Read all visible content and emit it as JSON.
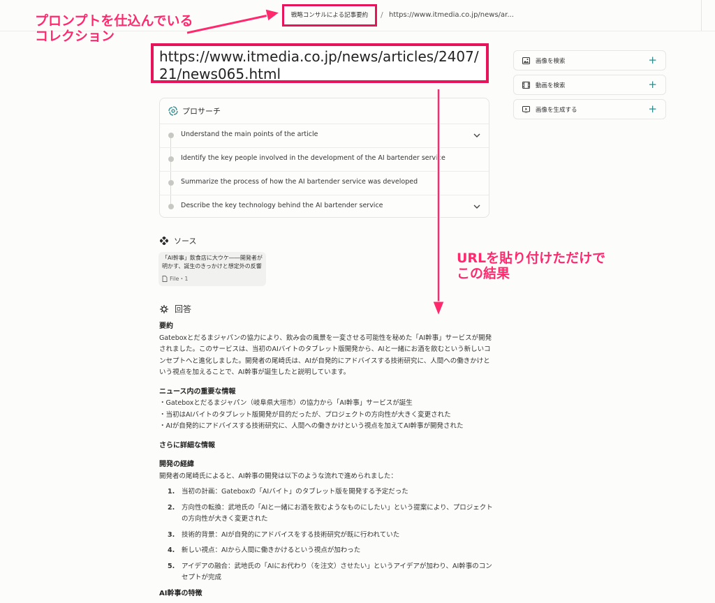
{
  "breadcrumb": {
    "collection": "戦略コンサルによる記事要約",
    "separator": "/",
    "page": "https://www.itmedia.co.jp/news/ar..."
  },
  "annotations": {
    "top_left_line1": "プロンプトを仕込んでいる",
    "top_left_line2": "コレクション",
    "right_line1": "URLを貼り付けただけで",
    "right_line2": "この結果"
  },
  "query": "https://www.itmedia.co.jp/news/articles/2407/21/news065.html",
  "pro_search": {
    "title": "プロサーチ",
    "steps": [
      {
        "text": "Understand the main points of the article"
      },
      {
        "text": "Identify the key people involved in the development of the AI bartender service"
      },
      {
        "text": "Summarize the process of how the AI bartender service was developed"
      },
      {
        "text": "Describe the key technology behind the AI bartender service"
      }
    ]
  },
  "sources": {
    "title": "ソース",
    "cards": [
      {
        "title": "「AI幹事」飲食店に大ウケ――開発者が明かす、誕生のきっかけと想定外の反響 人...",
        "meta": "File・1"
      }
    ]
  },
  "answer": {
    "title": "回答",
    "summary_heading": "要約",
    "summary": "Gateboxとだるまジャパンの協力により、飲み会の風景を一変させる可能性を秘めた「AI幹事」サービスが開発されました。このサービスは、当初のAIバイトのタブレット版開発から、AIと一緒にお酒を飲むという新しいコンセプトへと進化しました。開発者の尾崎氏は、AIが自発的にアドバイスする技術研究に、人間への働きかけという視点を加えることで、AI幹事が誕生したと説明しています。",
    "news_heading": "ニュース内の重要な情報",
    "news_items": [
      "・Gateboxとだるまジャパン（岐阜県大垣市）の協力から「AI幹事」サービスが誕生",
      "・当初はAIバイトのタブレット版開発が目的だったが、プロジェクトの方向性が大きく変更された",
      "・AIが自発的にアドバイスする技術研究に、人間への働きかけという視点を加えてAI幹事が開発された"
    ],
    "detail_heading": "さらに詳細な情報",
    "process_heading": "開発の経緯",
    "process_intro": "開発者の尾崎氏によると、AI幹事の開発は以下のような流れで進められました：",
    "process_steps": [
      {
        "num": "1.",
        "text": "当初の計画：Gateboxの「AIバイト」のタブレット版を開発する予定だった"
      },
      {
        "num": "2.",
        "text": "方向性の転換：武地氏の「AIと一緒にお酒を飲むようなものにしたい」という提案により、プロジェクトの方向性が大きく変更された"
      },
      {
        "num": "3.",
        "text": "技術的背景：AIが自発的にアドバイスをする技術研究が既に行われていた"
      },
      {
        "num": "4.",
        "text": "新しい視点：AIから人間に働きかけるという視点が加わった"
      },
      {
        "num": "5.",
        "text": "アイデアの融合：武地氏の「AIにお代わり（を注文）させたい」というアイデアが加わり、AI幹事のコンセプトが完成"
      }
    ],
    "features_heading": "AI幹事の特徴"
  },
  "sidebar": {
    "buttons": [
      {
        "label": "画像を検索",
        "icon": "image-icon"
      },
      {
        "label": "動画を検索",
        "icon": "video-icon"
      },
      {
        "label": "画像を生成する",
        "icon": "generate-image-icon"
      }
    ],
    "plus": "+"
  },
  "colors": {
    "annotation": "#e6145a",
    "accent": "#2a8a8a"
  }
}
